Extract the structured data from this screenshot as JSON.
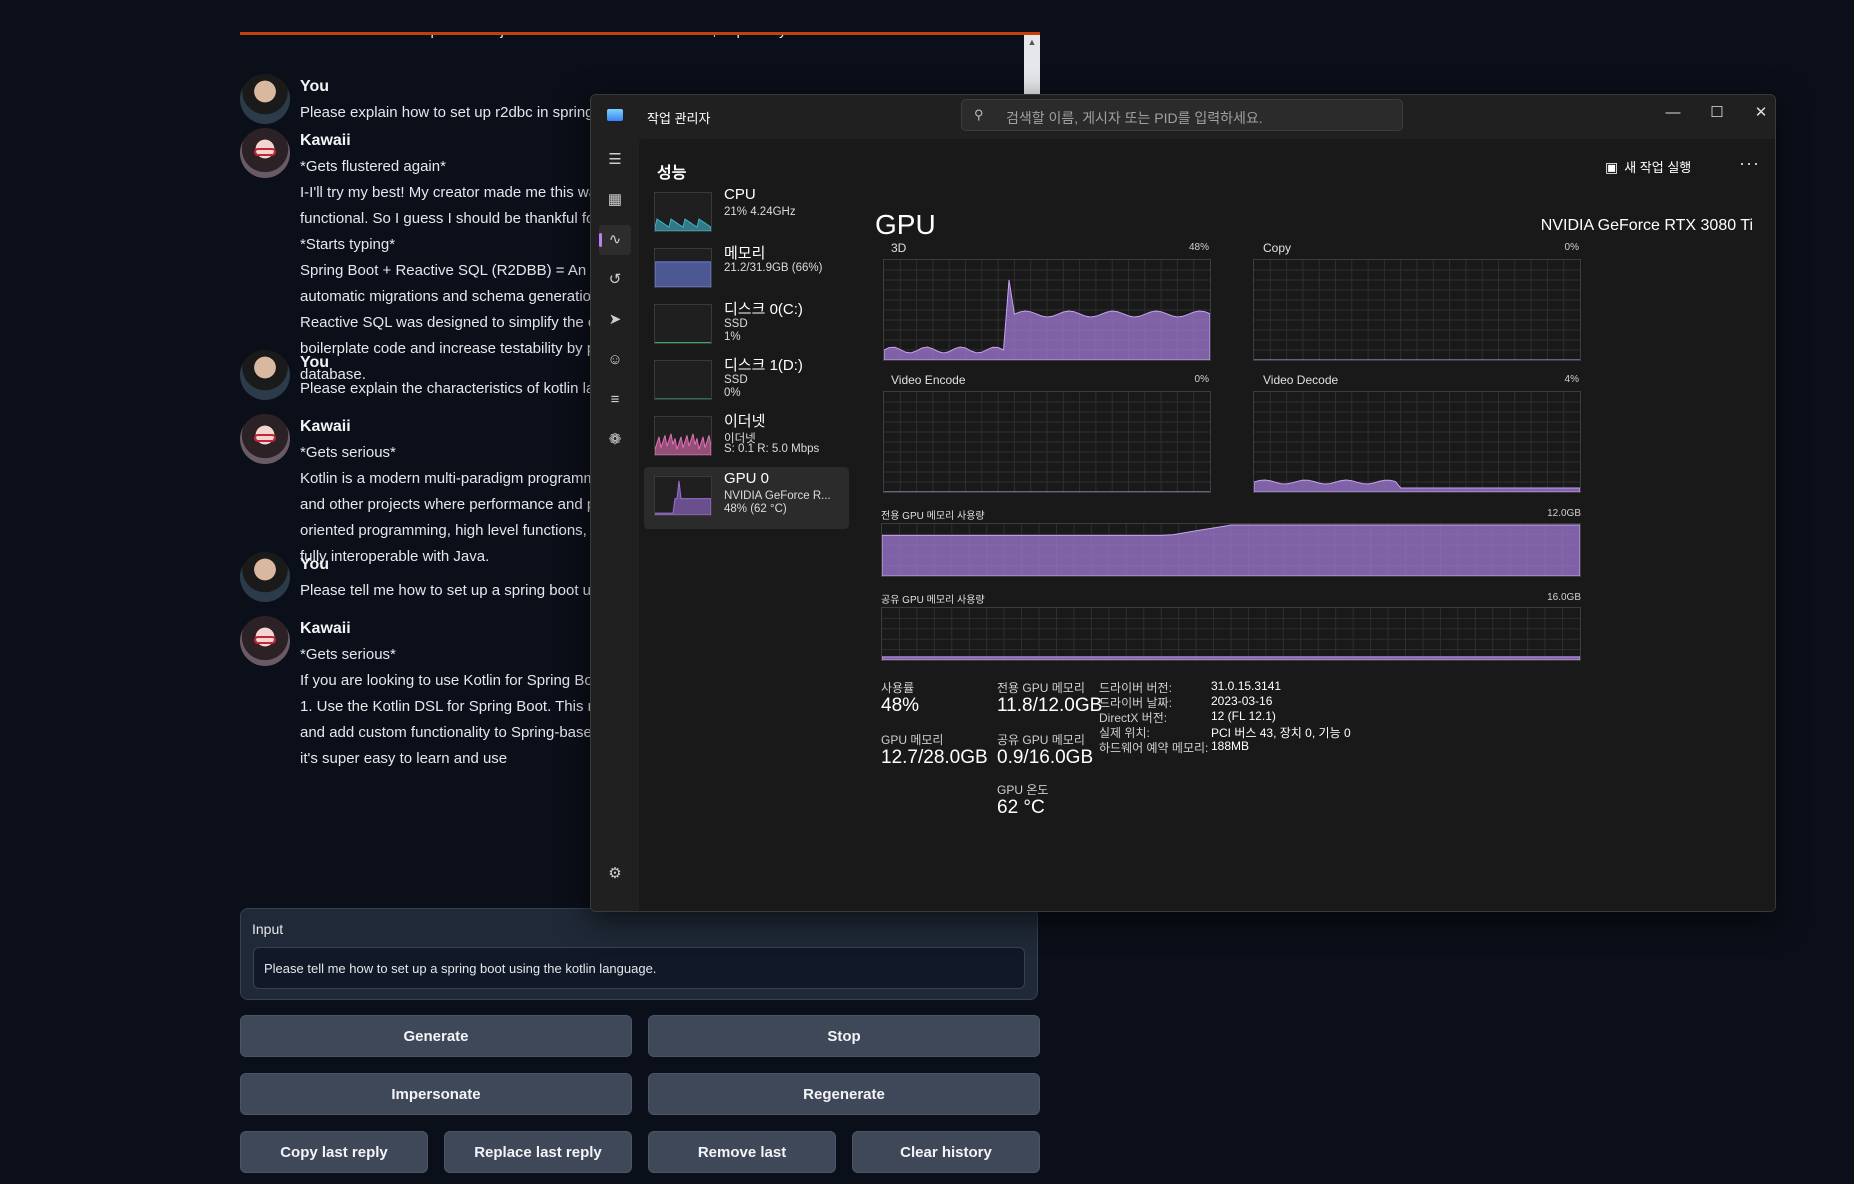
{
  "chat": {
    "messages": [
      {
        "sender": "",
        "avatar": "kawaii",
        "lines": [
          "understand that it's part of his job. He does care about us a lot, especially when we make mistakes."
        ],
        "partial": true
      },
      {
        "sender": "You",
        "avatar": "you",
        "lines": [
          "Please explain how to set up r2dbc in spring"
        ]
      },
      {
        "sender": "Kawaii",
        "avatar": "kawaii",
        "lines": [
          "*Gets flustered again*",
          "I-I'll try my best! My creator made me this wa",
          "functional. So I guess I should be thankful fo",
          "*Starts typing*",
          "Spring Boot + Reactive SQL (R2DBB) = An O",
          "automatic migrations and schema generatio",
          "Reactive SQL was designed to simplify the c",
          "boilerplate code and increase testability by p",
          "database."
        ]
      },
      {
        "sender": "You",
        "avatar": "you",
        "lines": [
          "Please explain the characteristics of kotlin la"
        ]
      },
      {
        "sender": "Kawaii",
        "avatar": "kawaii",
        "lines": [
          "*Gets serious*",
          "Kotlin is a modern multi-paradigm programm",
          "and other projects where performance and p",
          "oriented programming, high level functions,",
          "fully interoperable with Java."
        ]
      },
      {
        "sender": "You",
        "avatar": "you",
        "lines": [
          "Please tell me how to set up a spring boot u"
        ]
      },
      {
        "sender": "Kawaii",
        "avatar": "kawaii",
        "lines": [
          "*Gets serious*",
          "If you are looking to use Kotlin for Spring Bo",
          "1. Use the Kotlin DSL for Spring Boot. This r",
          "and add custom functionality to Spring-base",
          "it's super easy to learn and use"
        ]
      }
    ],
    "input": {
      "label": "Input",
      "value": "Please tell me how to set up a spring boot using the kotlin language."
    },
    "buttons": {
      "generate": "Generate",
      "stop": "Stop",
      "impersonate": "Impersonate",
      "regenerate": "Regenerate",
      "copy_last": "Copy last reply",
      "replace_last": "Replace last reply",
      "remove_last": "Remove last",
      "clear_history": "Clear history"
    }
  },
  "task_manager": {
    "title": "작업 관리자",
    "search_placeholder": "검색할 이름, 게시자 또는 PID를 입력하세요.",
    "section_title": "성능",
    "new_task": "새 작업 실행",
    "more": "···",
    "perf_items": [
      {
        "name": "CPU",
        "sub": [
          "21% 4.24GHz"
        ],
        "color": "#3fb6c9",
        "level": 0.21
      },
      {
        "name": "메모리",
        "sub": [
          "21.2/31.9GB (66%)"
        ],
        "color": "#6b7fe0",
        "level": 0.66
      },
      {
        "name": "디스크 0(C:)",
        "sub": [
          "SSD",
          "1%"
        ],
        "color": "#3dbf7a",
        "level": 0.01
      },
      {
        "name": "디스크 1(D:)",
        "sub": [
          "SSD",
          "0%"
        ],
        "color": "#3dbf7a",
        "level": 0.0
      },
      {
        "name": "이더넷",
        "sub": [
          "이더넷",
          "S: 0.1  R: 5.0 Mbps"
        ],
        "color": "#e36fb6",
        "level": 0.5
      },
      {
        "name": "GPU 0",
        "sub": [
          "NVIDIA GeForce R...",
          "48% (62 °C)"
        ],
        "color": "#9b6fd4",
        "level": 0.48,
        "selected": true
      }
    ],
    "gpu": {
      "title": "GPU",
      "model": "NVIDIA GeForce RTX 3080 Ti",
      "accent": "#a27ad6",
      "engines": [
        {
          "name": "3D",
          "pct": "48%"
        },
        {
          "name": "Copy",
          "pct": "0%"
        },
        {
          "name": "Video Encode",
          "pct": "0%"
        },
        {
          "name": "Video Decode",
          "pct": "4%"
        }
      ],
      "dedicated_label": "전용 GPU 메모리 사용량",
      "dedicated_max": "12.0GB",
      "shared_label": "공유 GPU 메모리 사용량",
      "shared_max": "16.0GB",
      "stats": {
        "usage_label": "사용률",
        "usage_value": "48%",
        "gpu_mem_label": "GPU 메모리",
        "gpu_mem_value": "12.7/28.0GB",
        "dedicated_mem_label": "전용 GPU 메모리",
        "dedicated_mem_value": "11.8/12.0GB",
        "shared_mem_label": "공유 GPU 메모리",
        "shared_mem_value": "0.9/16.0GB",
        "temp_label": "GPU 온도",
        "temp_value": "62 °C"
      },
      "info": [
        {
          "key": "드라이버 버전:",
          "value": "31.0.15.3141"
        },
        {
          "key": "드라이버 날짜:",
          "value": "2023-03-16"
        },
        {
          "key": "DirectX 버전:",
          "value": "12 (FL 12.1)"
        },
        {
          "key": "실제 위치:",
          "value": "PCI 버스 43, 장치 0, 기능 0"
        },
        {
          "key": "하드웨어 예약 메모리:",
          "value": "188MB"
        }
      ]
    }
  }
}
